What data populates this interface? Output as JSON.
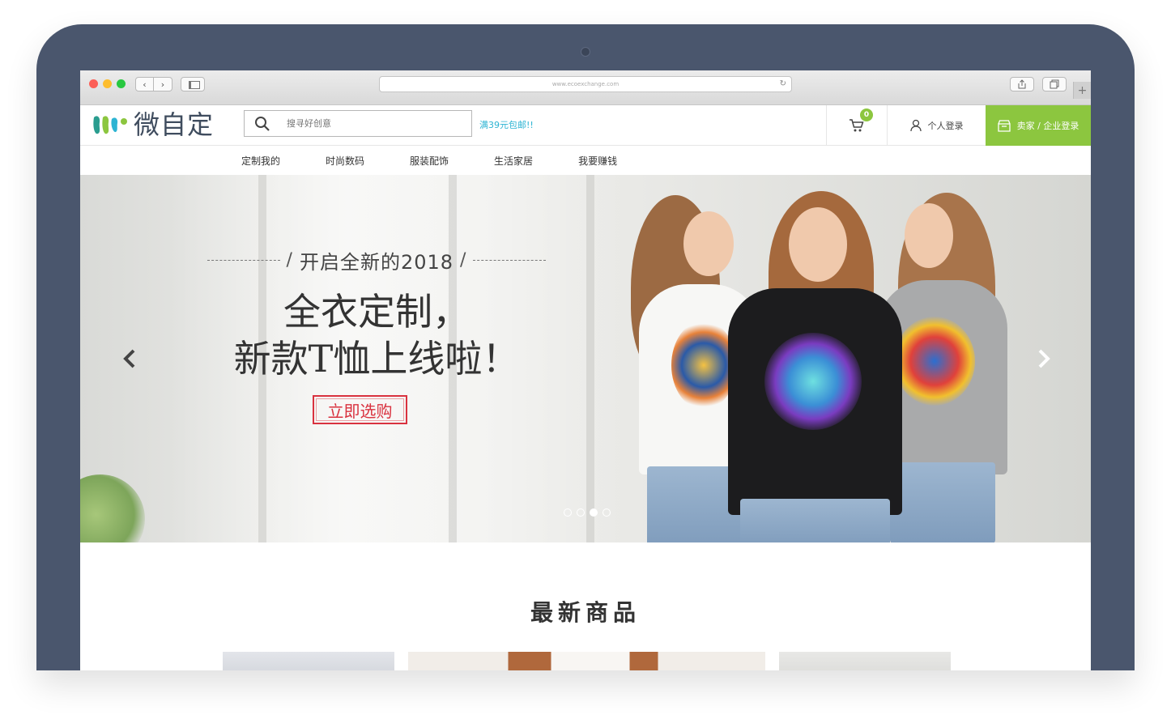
{
  "browser": {
    "url": "www.ecoexchange.com"
  },
  "header": {
    "logo_text": "微自定",
    "search_placeholder": "搜寻好创意",
    "promo": "满39元包邮!!",
    "cart_count": "0",
    "login_label": "个人登录",
    "seller_label": "卖家 / 企业登录"
  },
  "nav": {
    "items": [
      "定制我的",
      "时尚数码",
      "服装配饰",
      "生活家居",
      "我要赚钱"
    ]
  },
  "banner": {
    "tagline": "开启全新的2018",
    "headline_line1": "全衣定制，",
    "headline_line2": "新款T恤上线啦！",
    "cta": "立即选购",
    "slide_count": 4,
    "active_slide": 3
  },
  "section": {
    "title": "最新商品"
  },
  "colors": {
    "brand_green": "#8cc63f",
    "promo_blue": "#2db4d3",
    "cta_red": "#d9323f",
    "device_frame": "#4a566d"
  },
  "icons": [
    "search-icon",
    "cart-icon",
    "user-icon",
    "store-icon",
    "chevron-left-icon",
    "chevron-right-icon",
    "reload-icon",
    "share-icon",
    "tabs-icon"
  ]
}
